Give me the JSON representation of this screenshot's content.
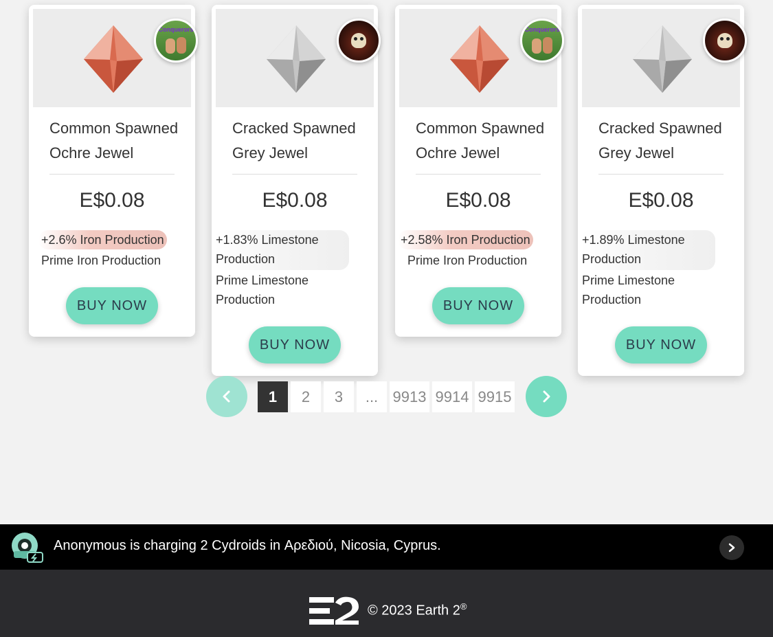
{
  "cards": [
    {
      "title_line1": "Common Spawned",
      "title_line2": "Ochre Jewel",
      "price": "E$0.08",
      "bonus": "+2.6% Iron Production",
      "prime_line1": "Prime Iron Production",
      "prime_line2": "",
      "buy": "BUY NOW",
      "gem_color": "#d96a4f",
      "avatar": "conquerors-avatar",
      "avatar_text": "Conquerors"
    },
    {
      "title_line1": "Cracked Spawned",
      "title_line2": "Grey Jewel",
      "price": "E$0.08",
      "bonus_line1": "+1.83% Limestone",
      "bonus_line2": "Production",
      "prime_line1": "Prime Limestone",
      "prime_line2": "Production",
      "buy": "BUY NOW",
      "gem_color": "#bdbdbd",
      "avatar": "pirate-skull-avatar"
    },
    {
      "title_line1": "Common Spawned",
      "title_line2": "Ochre Jewel",
      "price": "E$0.08",
      "bonus": "+2.58% Iron Production",
      "prime_line1": "Prime Iron Production",
      "prime_line2": "",
      "buy": "BUY NOW",
      "gem_color": "#d96a4f",
      "avatar": "conquerors-avatar",
      "avatar_text": "Conquerors"
    },
    {
      "title_line1": "Cracked Spawned",
      "title_line2": "Grey Jewel",
      "price": "E$0.08",
      "bonus_line1": "+1.89% Limestone",
      "bonus_line2": "Production",
      "prime_line1": "Prime Limestone",
      "prime_line2": "Production",
      "buy": "BUY NOW",
      "gem_color": "#bdbdbd",
      "avatar": "pirate-skull-avatar"
    }
  ],
  "pagination": {
    "prev_icon": "chevron-left-icon",
    "next_icon": "chevron-right-icon",
    "pages": [
      "1",
      "2",
      "3",
      "...",
      "9913",
      "9914",
      "9915"
    ],
    "active": "1",
    "accent": "#75dcc0"
  },
  "ticker": {
    "text": "Anonymous is charging 2 Cydroids in Αρεδιού, Nicosia, Cyprus.",
    "icon": "cydroid-charging-icon",
    "arrow_icon": "chevron-right-icon"
  },
  "footer": {
    "logo": "E2",
    "copyright": "© 2023 Earth 2",
    "registered": "®"
  }
}
